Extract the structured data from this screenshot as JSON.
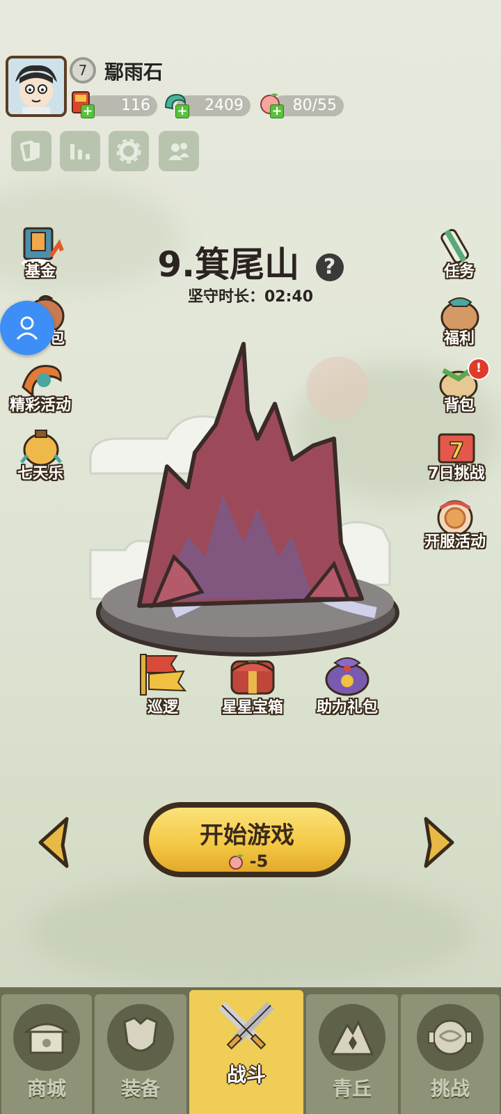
{
  "player": {
    "name": "鄢雨石",
    "level": "7"
  },
  "resources": [
    {
      "icon": "gold-ticket-icon",
      "value": "116"
    },
    {
      "icon": "jade-dragon-icon",
      "value": "2409"
    },
    {
      "icon": "peach-stamina-icon",
      "value": "80/55"
    }
  ],
  "quick_buttons": [
    {
      "icon": "cards-icon"
    },
    {
      "icon": "ranking-icon"
    },
    {
      "icon": "settings-gear-icon"
    },
    {
      "icon": "friends-icon"
    }
  ],
  "left_menu": [
    {
      "label": "基金",
      "icon": "fund-icon"
    },
    {
      "label": "包",
      "icon": "pack-icon"
    },
    {
      "label": "精彩活动",
      "icon": "event-icon"
    },
    {
      "label": "七天乐",
      "icon": "seven-day-icon"
    }
  ],
  "right_menu": [
    {
      "label": "任务",
      "icon": "scroll-quest-icon"
    },
    {
      "label": "福利",
      "icon": "welfare-bag-icon"
    },
    {
      "label": "背包",
      "icon": "backpack-icon",
      "badge": "!"
    },
    {
      "label": "7日挑战",
      "icon": "seven-day-challenge-icon"
    },
    {
      "label": "开服活动",
      "icon": "server-event-icon"
    }
  ],
  "stage": {
    "title": "9.箕尾山",
    "timer_label": "坚守时长：02:40"
  },
  "stage_actions": [
    {
      "label": "巡逻",
      "icon": "patrol-flag-icon"
    },
    {
      "label": "星星宝箱",
      "icon": "star-chest-icon"
    },
    {
      "label": "助力礼包",
      "icon": "gift-bag-icon"
    }
  ],
  "start_button": {
    "label": "开始游戏",
    "cost": "-5"
  },
  "bottom_nav": [
    {
      "label": "商城",
      "icon": "shop-icon",
      "active": false
    },
    {
      "label": "装备",
      "icon": "armor-icon",
      "active": false
    },
    {
      "label": "战斗",
      "icon": "crossed-swords-icon",
      "active": true
    },
    {
      "label": "青丘",
      "icon": "mountain-icon",
      "active": false
    },
    {
      "label": "挑战",
      "icon": "challenge-icon",
      "active": false
    }
  ],
  "colors": {
    "accent": "#efcd57",
    "nav_bg": "#6d6f52",
    "mountain": "#9c4a5a",
    "float_button": "#3d8ef7"
  }
}
